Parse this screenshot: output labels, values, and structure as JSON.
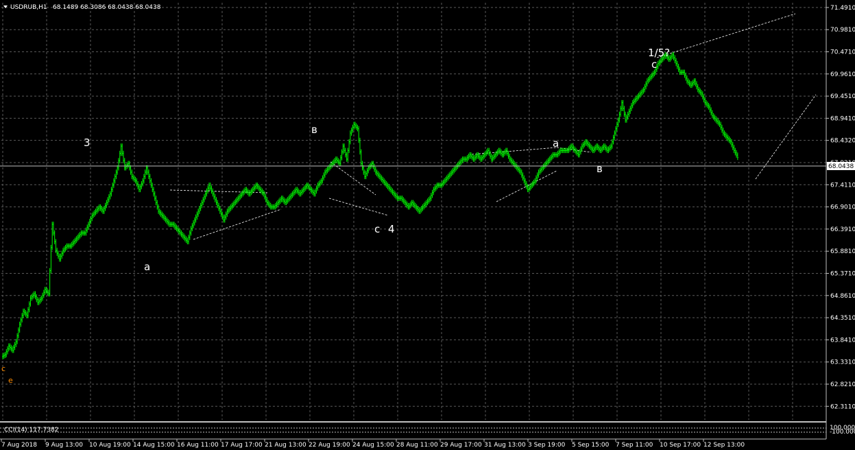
{
  "window": {
    "symbol_label": "USDRUB,H1",
    "ohlc_text": "68.1489 68.3086 68.0438 68.0438"
  },
  "price_axis": {
    "ticks": [
      "71.4910",
      "70.9810",
      "70.4710",
      "69.9610",
      "69.4510",
      "68.9410",
      "68.4320",
      "67.9210",
      "67.4110",
      "66.9010",
      "66.3910",
      "65.8810",
      "65.3710",
      "64.8610",
      "64.3510",
      "63.8410",
      "63.3310",
      "62.8210",
      "62.3110"
    ],
    "current_price": "68.0438"
  },
  "time_axis": {
    "labels": [
      "7 Aug 2018",
      "9 Aug 13:00",
      "10 Aug 19:00",
      "14 Aug 15:00",
      "16 Aug 11:00",
      "17 Aug 17:00",
      "21 Aug 13:00",
      "22 Aug 19:00",
      "24 Aug 15:00",
      "28 Aug 11:00",
      "29 Aug 17:00",
      "31 Aug 13:00",
      "3 Sep 19:00",
      "5 Sep 15:00",
      "7 Sep 11:00",
      "10 Sep 17:00",
      "12 Sep 13:00"
    ]
  },
  "indicator": {
    "label": "CCI(14) 117.7382",
    "axis_ticks": [
      "100.000",
      "-100.000"
    ]
  },
  "wave_labels": [
    {
      "text": "3",
      "color": "#ffffff"
    },
    {
      "text": "a",
      "color": "#ffffff"
    },
    {
      "text": "в",
      "color": "#ffffff"
    },
    {
      "text": "c",
      "color": "#ffffff"
    },
    {
      "text": "4",
      "color": "#ffffff"
    },
    {
      "text": "a",
      "color": "#ffffff"
    },
    {
      "text": "в",
      "color": "#ffffff"
    },
    {
      "text": "c",
      "color": "#ffffff"
    },
    {
      "text": "1/5?",
      "color": "#ffffff"
    },
    {
      "text": "c",
      "color": "#ff8c00"
    },
    {
      "text": "e",
      "color": "#ff8c00"
    }
  ],
  "colors": {
    "background": "#000000",
    "candles": "#00ff00",
    "grid": "#5a5a5a",
    "trendlines": "#ffffff",
    "current_price_box": "#ffffff"
  },
  "chart_data": {
    "type": "line",
    "title": "USDRUB,H1",
    "xlabel": "",
    "ylabel": "",
    "ylim": [
      62.0,
      71.6
    ],
    "grid": true,
    "categories": [
      "7 Aug 2018",
      "9 Aug 13:00",
      "10 Aug 19:00",
      "14 Aug 15:00",
      "16 Aug 11:00",
      "17 Aug 17:00",
      "21 Aug 13:00",
      "22 Aug 19:00",
      "24 Aug 15:00",
      "28 Aug 11:00",
      "29 Aug 17:00",
      "31 Aug 13:00",
      "3 Sep 19:00",
      "5 Sep 15:00",
      "7 Sep 11:00",
      "10 Sep 17:00",
      "12 Sep 13:00"
    ],
    "series": [
      {
        "values": [
          [
            0,
            63.45
          ],
          [
            3,
            63.5
          ],
          [
            6,
            63.7
          ],
          [
            9,
            63.6
          ],
          [
            12,
            63.8
          ],
          [
            15,
            64.2
          ],
          [
            18,
            64.5
          ],
          [
            21,
            64.4
          ],
          [
            24,
            64.8
          ],
          [
            27,
            64.9
          ],
          [
            30,
            64.7
          ],
          [
            33,
            64.8
          ],
          [
            36,
            65.0
          ],
          [
            39,
            64.9
          ],
          [
            42,
            66.5
          ],
          [
            45,
            65.9
          ],
          [
            48,
            65.7
          ],
          [
            51,
            65.9
          ],
          [
            54,
            66.0
          ],
          [
            57,
            66.0
          ],
          [
            60,
            66.1
          ],
          [
            63,
            66.2
          ],
          [
            66,
            66.3
          ],
          [
            69,
            66.3
          ],
          [
            72,
            66.5
          ],
          [
            75,
            66.7
          ],
          [
            78,
            66.8
          ],
          [
            81,
            66.9
          ],
          [
            84,
            66.8
          ],
          [
            87,
            67.0
          ],
          [
            90,
            67.2
          ],
          [
            93,
            67.5
          ],
          [
            96,
            67.8
          ],
          [
            99,
            68.3
          ],
          [
            102,
            67.8
          ],
          [
            105,
            67.9
          ],
          [
            108,
            67.6
          ],
          [
            111,
            67.5
          ],
          [
            114,
            67.3
          ],
          [
            117,
            67.5
          ],
          [
            120,
            67.8
          ],
          [
            130,
            66.8
          ],
          [
            133,
            66.7
          ],
          [
            136,
            66.6
          ],
          [
            139,
            66.5
          ],
          [
            142,
            66.5
          ],
          [
            145,
            66.4
          ],
          [
            148,
            66.3
          ],
          [
            151,
            66.2
          ],
          [
            154,
            66.1
          ],
          [
            157,
            66.4
          ],
          [
            160,
            66.6
          ],
          [
            163,
            66.8
          ],
          [
            166,
            67.0
          ],
          [
            169,
            67.2
          ],
          [
            172,
            67.4
          ],
          [
            175,
            67.2
          ],
          [
            178,
            67.0
          ],
          [
            181,
            66.8
          ],
          [
            184,
            66.6
          ],
          [
            187,
            66.8
          ],
          [
            190,
            66.9
          ],
          [
            193,
            67.0
          ],
          [
            196,
            67.1
          ],
          [
            199,
            67.2
          ],
          [
            202,
            67.3
          ],
          [
            205,
            67.2
          ],
          [
            208,
            67.3
          ],
          [
            211,
            67.4
          ],
          [
            214,
            67.3
          ],
          [
            217,
            67.2
          ],
          [
            220,
            67.0
          ],
          [
            223,
            66.9
          ],
          [
            226,
            66.9
          ],
          [
            229,
            67.0
          ],
          [
            232,
            67.1
          ],
          [
            235,
            67.0
          ],
          [
            238,
            67.1
          ],
          [
            241,
            67.2
          ],
          [
            244,
            67.3
          ],
          [
            247,
            67.2
          ],
          [
            250,
            67.3
          ],
          [
            253,
            67.4
          ],
          [
            256,
            67.3
          ],
          [
            259,
            67.2
          ],
          [
            262,
            67.4
          ],
          [
            265,
            67.5
          ],
          [
            268,
            67.7
          ],
          [
            271,
            67.8
          ],
          [
            274,
            67.9
          ],
          [
            277,
            68.0
          ],
          [
            280,
            67.9
          ],
          [
            283,
            68.3
          ],
          [
            286,
            68.0
          ],
          [
            289,
            68.6
          ],
          [
            292,
            68.8
          ],
          [
            295,
            68.7
          ],
          [
            298,
            67.9
          ],
          [
            301,
            67.6
          ],
          [
            304,
            67.8
          ],
          [
            307,
            67.9
          ],
          [
            310,
            67.7
          ],
          [
            313,
            67.6
          ],
          [
            316,
            67.5
          ],
          [
            319,
            67.4
          ],
          [
            322,
            67.3
          ],
          [
            325,
            67.2
          ],
          [
            328,
            67.1
          ],
          [
            331,
            67.1
          ],
          [
            334,
            67.0
          ],
          [
            337,
            66.9
          ],
          [
            340,
            67.0
          ],
          [
            343,
            66.9
          ],
          [
            346,
            66.8
          ],
          [
            349,
            66.9
          ],
          [
            352,
            67.0
          ],
          [
            355,
            67.1
          ],
          [
            358,
            67.3
          ],
          [
            361,
            67.4
          ],
          [
            364,
            67.4
          ],
          [
            367,
            67.5
          ],
          [
            370,
            67.6
          ],
          [
            373,
            67.7
          ],
          [
            376,
            67.8
          ],
          [
            379,
            67.9
          ],
          [
            382,
            68.0
          ],
          [
            385,
            68.0
          ],
          [
            388,
            68.1
          ],
          [
            391,
            68.0
          ],
          [
            394,
            68.1
          ],
          [
            397,
            68.0
          ],
          [
            400,
            68.1
          ],
          [
            403,
            68.2
          ],
          [
            406,
            68.0
          ],
          [
            409,
            68.1
          ],
          [
            412,
            68.2
          ],
          [
            415,
            68.1
          ],
          [
            418,
            68.2
          ],
          [
            421,
            68.0
          ],
          [
            424,
            67.9
          ],
          [
            427,
            67.8
          ],
          [
            430,
            67.7
          ],
          [
            433,
            67.5
          ],
          [
            436,
            67.3
          ],
          [
            439,
            67.4
          ],
          [
            442,
            67.5
          ],
          [
            445,
            67.7
          ],
          [
            448,
            67.8
          ],
          [
            451,
            67.9
          ],
          [
            454,
            68.0
          ],
          [
            457,
            68.1
          ],
          [
            460,
            68.1
          ],
          [
            463,
            68.2
          ],
          [
            466,
            68.2
          ],
          [
            469,
            68.2
          ],
          [
            472,
            68.3
          ],
          [
            475,
            68.2
          ],
          [
            478,
            68.1
          ],
          [
            481,
            68.3
          ],
          [
            484,
            68.4
          ],
          [
            487,
            68.3
          ],
          [
            490,
            68.2
          ],
          [
            493,
            68.3
          ],
          [
            496,
            68.2
          ],
          [
            499,
            68.3
          ],
          [
            502,
            68.2
          ],
          [
            505,
            68.3
          ],
          [
            508,
            68.6
          ],
          [
            511,
            68.9
          ],
          [
            514,
            69.3
          ],
          [
            517,
            68.9
          ],
          [
            520,
            69.1
          ],
          [
            523,
            69.3
          ],
          [
            526,
            69.4
          ],
          [
            529,
            69.5
          ],
          [
            532,
            69.6
          ],
          [
            535,
            69.8
          ],
          [
            538,
            69.9
          ],
          [
            541,
            70.0
          ],
          [
            544,
            70.2
          ],
          [
            547,
            70.3
          ],
          [
            550,
            70.4
          ],
          [
            553,
            70.3
          ],
          [
            556,
            70.4
          ],
          [
            559,
            70.2
          ],
          [
            562,
            70.0
          ],
          [
            565,
            70.0
          ],
          [
            568,
            69.8
          ],
          [
            571,
            69.7
          ],
          [
            574,
            69.8
          ],
          [
            577,
            69.6
          ],
          [
            580,
            69.5
          ],
          [
            583,
            69.3
          ],
          [
            586,
            69.2
          ],
          [
            589,
            69.0
          ],
          [
            592,
            68.9
          ],
          [
            595,
            68.8
          ],
          [
            598,
            68.6
          ],
          [
            601,
            68.5
          ],
          [
            604,
            68.4
          ],
          [
            607,
            68.2
          ],
          [
            610,
            68.04
          ]
        ]
      }
    ]
  }
}
